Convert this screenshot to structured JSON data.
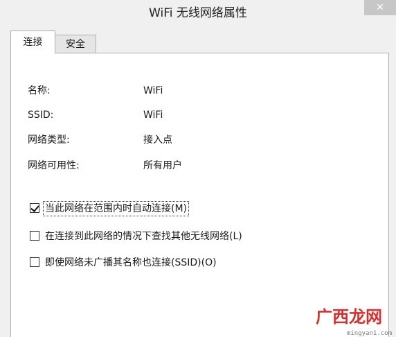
{
  "window": {
    "title": "WiFi 无线网络属性",
    "close_label": "✕"
  },
  "tabs": [
    {
      "label": "连接",
      "active": true
    },
    {
      "label": "安全",
      "active": false
    }
  ],
  "info": [
    {
      "label": "名称:",
      "value": "WiFi"
    },
    {
      "label": "SSID:",
      "value": "WiFi"
    },
    {
      "label": "网络类型:",
      "value": "接入点"
    },
    {
      "label": "网络可用性:",
      "value": "所有用户"
    }
  ],
  "options": [
    {
      "label": "当此网络在范围内时自动连接(M)",
      "checked": true
    },
    {
      "label": "在连接到此网络的情况下查找其他无线网络(L)",
      "checked": false
    },
    {
      "label": "即使网络未广播其名称也连接(SSID)(O)",
      "checked": false
    }
  ],
  "watermark": {
    "text": "广西龙网",
    "url": "mingyan1.com"
  }
}
